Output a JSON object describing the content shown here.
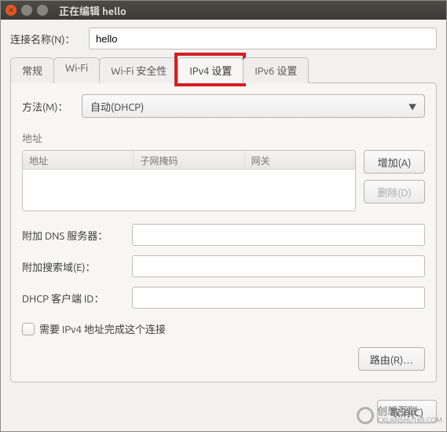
{
  "titlebar": {
    "title": "正在编辑 hello"
  },
  "connection": {
    "label": "连接名称(N)：",
    "value": "hello"
  },
  "tabs": {
    "items": [
      {
        "label": "常规"
      },
      {
        "label": "Wi-Fi"
      },
      {
        "label": "Wi-Fi 安全性"
      },
      {
        "label": "IPv4 设置"
      },
      {
        "label": "IPv6 设置"
      }
    ]
  },
  "method": {
    "label": "方法(M)：",
    "selected": "自动(DHCP)"
  },
  "address": {
    "section": "地址",
    "cols": {
      "addr": "地址",
      "mask": "子网掩码",
      "gw": "网关"
    },
    "add": "增加(A)",
    "del": "删除(D)"
  },
  "dns": {
    "label": "附加 DNS 服务器：",
    "value": ""
  },
  "search": {
    "label": "附加搜索域(E)：",
    "value": ""
  },
  "dhcp": {
    "label": "DHCP 客户端 ID：",
    "value": ""
  },
  "require": {
    "label": "需要 IPv4 地址完成这个连接"
  },
  "routes": {
    "label": "路由(R)…"
  },
  "footer": {
    "cancel": "取消(C)"
  },
  "watermark": {
    "brand": "创想互联",
    "sub": "CXLANSHU168.COM"
  }
}
